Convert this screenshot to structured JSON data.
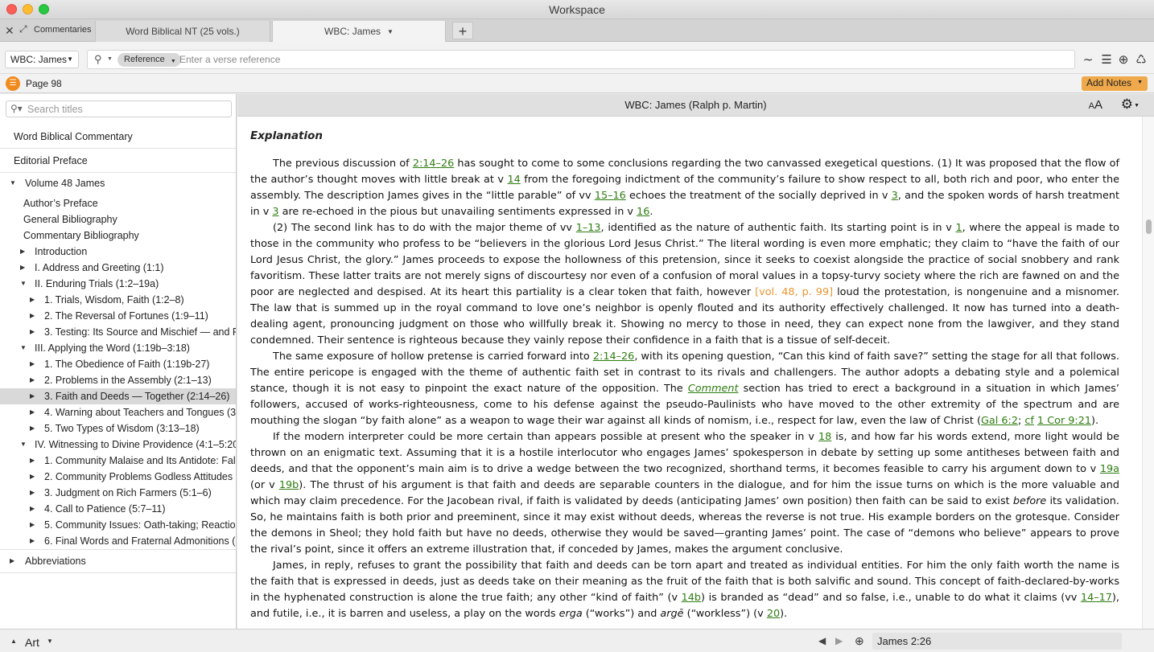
{
  "window": {
    "title": "Workspace"
  },
  "tabstrip": {
    "panel_label": "Commentaries",
    "tabs": [
      {
        "label": "Word Biblical NT (25 vols.)"
      },
      {
        "label": "WBC: James"
      }
    ],
    "new_tab": "+"
  },
  "toolbar": {
    "resource": "WBC: James",
    "search_mode": "Reference",
    "search_placeholder": "Enter a verse reference",
    "icons": [
      "wave-icon",
      "list-icon",
      "add-circle-icon",
      "recycle-icon"
    ]
  },
  "pagerow": {
    "page": "Page 98",
    "add_notes": "Add Notes"
  },
  "sidebar": {
    "search_placeholder": "Search titles",
    "items": [
      {
        "label": "Word Biblical Commentary"
      },
      {
        "label": "Editorial Preface"
      },
      {
        "label": "Volume 48 James"
      },
      {
        "label": "Author’s Preface"
      },
      {
        "label": "General Bibliography"
      },
      {
        "label": "Commentary Bibliography"
      },
      {
        "label": "Introduction"
      },
      {
        "label": "I. Address and Greeting (1:1)"
      },
      {
        "label": "II. Enduring Trials (1:2–19a)"
      },
      {
        "label": "1. Trials, Wisdom, Faith (1:2–8)"
      },
      {
        "label": "2. The Reversal of Fortunes (1:9–11)"
      },
      {
        "label": "3. Testing: Its Source and Mischief — and R…"
      },
      {
        "label": "III. Applying the Word (1:19b–3:18)"
      },
      {
        "label": "1. The Obedience of Faith (1:19b-27)"
      },
      {
        "label": "2. Problems in the Assembly (2:1–13)"
      },
      {
        "label": "3. Faith and Deeds — Together (2:14–26)"
      },
      {
        "label": "4. Warning about Teachers and Tongues (3:…"
      },
      {
        "label": "5. Two Types of Wisdom (3:13–18)"
      },
      {
        "label": "IV. Witnessing to Divine Providence (4:1–5:20)"
      },
      {
        "label": "1. Community Malaise and Its Antidote: Fal…"
      },
      {
        "label": "2. Community Problems Godless Attitudes (…"
      },
      {
        "label": "3. Judgment on Rich Farmers (5:1–6)"
      },
      {
        "label": "4. Call to Patience (5:7–11)"
      },
      {
        "label": "5. Community Issues: Oath-taking; Reactio…"
      },
      {
        "label": "6. Final Words and Fraternal Admonitions (…"
      },
      {
        "label": "Abbreviations"
      }
    ]
  },
  "reader": {
    "title": "WBC: James (Ralph p. Martin)",
    "font_size_label": "AA",
    "heading": "Explanation",
    "paragraphs": [
      [
        {
          "t": "The previous discussion of "
        },
        {
          "t": "2:14–26",
          "r": 1
        },
        {
          "t": " has sought to come to some conclusions regarding the two canvassed exegetical questions. (1) It was proposed that the flow of the author’s thought moves with little break at v "
        },
        {
          "t": "14",
          "r": 1
        },
        {
          "t": " from the foregoing indictment of the community’s failure to show respect to all, both rich and poor, who enter the assembly. The description James gives in the “little parable” of vv "
        },
        {
          "t": "15–16",
          "r": 1
        },
        {
          "t": " echoes the treatment of the socially deprived in v "
        },
        {
          "t": "3",
          "r": 1
        },
        {
          "t": ", and the spoken words of harsh treatment in v "
        },
        {
          "t": "3",
          "r": 1
        },
        {
          "t": " are re-echoed in the pious but unavailing sentiments expressed in v "
        },
        {
          "t": "16",
          "r": 1
        },
        {
          "t": "."
        }
      ],
      [
        {
          "t": "(2) The second link has to do with the major theme of vv "
        },
        {
          "t": "1–13",
          "r": 1
        },
        {
          "t": ", identified as the nature of authentic faith. Its starting point is in v "
        },
        {
          "t": "1",
          "r": 1
        },
        {
          "t": ", where the appeal is made to those in the community who profess to be “believers in the glorious Lord Jesus Christ.” The literal wording is even more emphatic; they claim to “have the faith of our Lord Jesus Christ, the glory.” James proceeds to expose the hollowness of this pretension, since it seeks to coexist alongside the practice of social snobbery and rank favoritism. These latter traits are not merely signs of discourtesy nor even of a confusion of moral values in a topsy-turvy society where the rich are fawned on and the poor are neglected and despised. At its heart this partiality is a clear token that faith, however "
        },
        {
          "t": "[vol. 48, p. 99]",
          "p": 1
        },
        {
          "t": " loud the protestation, is nongenuine and a misnomer. The law that is summed up in the royal command to love one’s neighbor is openly flouted and its authority effectively challenged. It now has turned into a death-dealing agent, pronouncing judgment on those who willfully break it. Showing no mercy to those in need, they can expect none from the lawgiver, and they stand condemned. Their sentence is righteous because they vainly repose their confidence in a faith that is a tissue of self-deceit."
        }
      ],
      [
        {
          "t": "The same exposure of hollow pretense is carried forward into "
        },
        {
          "t": "2:14–26",
          "r": 1
        },
        {
          "t": ", with its opening question, “Can this kind of faith save?” setting the stage for all that follows. The entire pericope is engaged with the theme of authentic faith set in contrast to its rivals and challengers. The author adopts a debating style and a polemical stance, though it is not easy to pinpoint the exact nature of the opposition. The "
        },
        {
          "t": "Comment",
          "r": 1,
          "i": 1
        },
        {
          "t": " section has tried to erect a background in a situation in which James’ followers, accused of works-righteousness, come to his defense against the pseudo-Paulinists who have moved to the other extremity of the spectrum and are mouthing the slogan “by faith alone” as a weapon to wage their war against all kinds of nomism, i.e., respect for law, even the law of Christ ("
        },
        {
          "t": "Gal 6:2",
          "r": 1
        },
        {
          "t": "; "
        },
        {
          "t": "cf",
          "r": 1
        },
        {
          "t": " "
        },
        {
          "t": "1 Cor 9:21",
          "r": 1
        },
        {
          "t": ")."
        }
      ],
      [
        {
          "t": "If the modern interpreter could be more certain than appears possible at present who the speaker in v "
        },
        {
          "t": "18",
          "r": 1
        },
        {
          "t": " is, and how far his words extend, more light would be thrown on an enigmatic text. Assuming that it is a hostile interlocutor who engages James’ spokesperson in debate by setting up some antitheses between faith and deeds, and that the opponent’s main aim is to drive a wedge between the two recognized, shorthand terms, it becomes feasible to carry his argument down to v "
        },
        {
          "t": "19a",
          "r": 1
        },
        {
          "t": " (or v "
        },
        {
          "t": "19b",
          "r": 1
        },
        {
          "t": "). The thrust of his argument is that faith and deeds are separable counters in the dialogue, and for him the issue turns on which is the more valuable and which may claim precedence. For the Jacobean rival, if faith is validated by deeds (anticipating James’ own position) then faith can be said to exist "
        },
        {
          "t": "before",
          "i": 1
        },
        {
          "t": " its validation. So, he maintains faith is both prior and preeminent, since it may exist without deeds, whereas the reverse is not true. His example borders on the grotesque. Consider the demons in Sheol; they hold faith but have no deeds, otherwise they would be saved—granting James’ point. The case of “demons who believe” appears to prove the rival’s point, since it offers an extreme illustration that, if conceded by James, makes the argument conclusive."
        }
      ],
      [
        {
          "t": "James, in reply, refuses to grant the possibility that faith and deeds can be torn apart and treated as individual entities. For him the only faith worth the name is the faith that is expressed in deeds, just as deeds take on their meaning as the fruit of the faith that is both salvific and sound. This concept of faith-declared-by-works in the hyphenated construction is alone the true faith; any other “kind of faith” (v "
        },
        {
          "t": "14b",
          "r": 1
        },
        {
          "t": ") is branded as “dead” and so false, i.e., unable to do what it claims (vv "
        },
        {
          "t": "14–17",
          "r": 1
        },
        {
          "t": "), and futile, i.e., it is barren and useless, a play on the words "
        },
        {
          "t": "erga",
          "i": 1
        },
        {
          "t": " (“works”) and "
        },
        {
          "t": "argē",
          "i": 1
        },
        {
          "t": " (“workless”) (v "
        },
        {
          "t": "20",
          "r": 1
        },
        {
          "t": ")."
        }
      ]
    ]
  },
  "statusbar": {
    "label": "Art",
    "reference": "James  2:26"
  },
  "colors": {
    "accent_orange": "#f08a1c",
    "verse_link_green": "#2e7d10",
    "page_ref_orange": "#e89630"
  }
}
